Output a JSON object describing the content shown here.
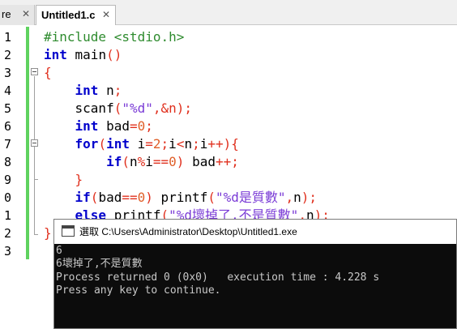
{
  "tabs": [
    {
      "label": "re",
      "close": "✕"
    },
    {
      "label": "Untitled1.c",
      "close": "✕"
    }
  ],
  "line_numbers": [
    "1",
    "2",
    "3",
    "4",
    "5",
    "6",
    "7",
    "8",
    "9",
    "0",
    "1",
    "2",
    "3"
  ],
  "code_lines": [
    [
      "#include <stdio.h>"
    ],
    [
      "int",
      " main",
      "()"
    ],
    [
      "{"
    ],
    [
      "    ",
      "int",
      " n",
      ";"
    ],
    [
      "    ",
      "scanf",
      "(",
      "\"%d\"",
      ",&n",
      ");"
    ],
    [
      "    ",
      "int",
      " bad",
      "=",
      "0",
      ";"
    ],
    [
      "    ",
      "for",
      "(",
      "int",
      " i",
      "=",
      "2",
      ";",
      "i",
      "<",
      "n",
      ";",
      "i",
      "++",
      "){"
    ],
    [
      "        ",
      "if",
      "(",
      "n",
      "%",
      "i",
      "==",
      "0",
      ")",
      " bad",
      "++;"
    ],
    [
      "    ",
      "}"
    ],
    [
      "    ",
      "if",
      "(",
      "bad",
      "==",
      "0",
      ")",
      " printf",
      "(",
      "\"%d是質數\"",
      ",",
      "n",
      ");"
    ],
    [
      "    ",
      "else",
      " printf",
      "(",
      "\"%d壞掉了,不是質數\"",
      ",",
      "n",
      ");"
    ],
    [
      "}"
    ],
    [
      ""
    ]
  ],
  "code_classes": [
    [
      "pre"
    ],
    [
      "kw",
      "",
      "op"
    ],
    [
      "op"
    ],
    [
      "",
      "kw",
      "",
      "op"
    ],
    [
      "",
      "",
      "op",
      "str",
      "op",
      "op"
    ],
    [
      "",
      "kw",
      "",
      "op",
      "num",
      "op"
    ],
    [
      "",
      "kw",
      "op",
      "kw",
      "",
      "op",
      "num",
      "op",
      "",
      "op",
      "",
      "op",
      "",
      "op",
      "op"
    ],
    [
      "",
      "kw",
      "op",
      "",
      "op",
      "",
      "op",
      "num",
      "op",
      "",
      "op"
    ],
    [
      "",
      "op"
    ],
    [
      "",
      "kw",
      "op",
      "",
      "op",
      "num",
      "op",
      "",
      "op",
      "str",
      "op",
      "",
      "op"
    ],
    [
      "",
      "kw",
      "",
      "op",
      "str",
      "op",
      "",
      "op"
    ],
    [
      "op"
    ],
    [
      ""
    ]
  ],
  "console": {
    "title": "選取 C:\\Users\\Administrator\\Desktop\\Untitled1.exe",
    "lines": [
      "6",
      "6壞掉了,不是質數",
      "Process returned 0 (0x0)   execution time : 4.228 s",
      "Press any key to continue."
    ]
  }
}
